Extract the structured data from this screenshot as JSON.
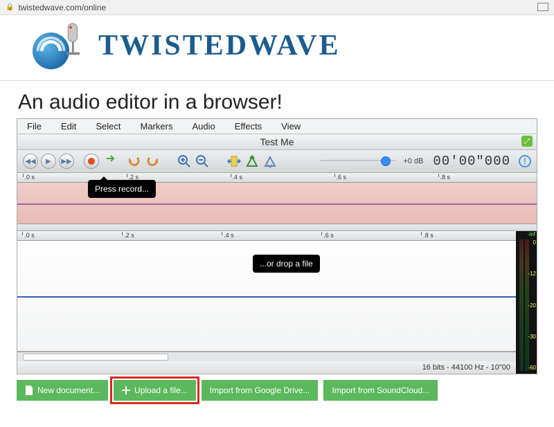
{
  "browser": {
    "url": "twistedwave.com/online"
  },
  "brand": "TWISTEDWAVE",
  "tagline": "An audio editor in a browser!",
  "menu": {
    "file": "File",
    "edit": "Edit",
    "select": "Select",
    "markers": "Markers",
    "audio": "Audio",
    "effects": "Effects",
    "view": "View"
  },
  "title": "Test Me",
  "toolbar": {
    "db_label": "+0 dB",
    "timecode": "00'00\"000"
  },
  "timeline": {
    "t0": ".0 s",
    "t2": ".2 s",
    "t4": ".4 s",
    "t6": ".6 s",
    "t8": ".8 s"
  },
  "tooltips": {
    "record": "Press record...",
    "drop": "...or drop a file"
  },
  "meter": {
    "inf": "-inf",
    "v0": "0",
    "v12": "-12",
    "v20": "-20",
    "v30": "-30",
    "v60": "-60"
  },
  "status": "16 bits - 44100 Hz - 10\"00",
  "actions": {
    "newdoc": "New document...",
    "upload": "Upload a file...",
    "gdrive": "Import from Google Drive...",
    "soundcloud": "Import from SoundCloud..."
  }
}
